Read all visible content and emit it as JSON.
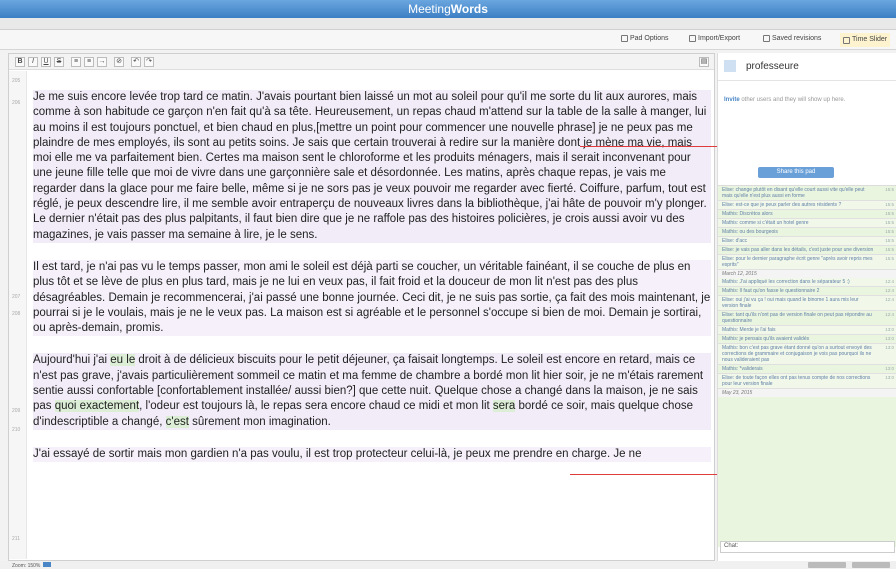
{
  "app": {
    "title_prefix": "Meeting",
    "title_bold": "Words"
  },
  "menu": {
    "pad_options": "Pad Options",
    "import_export": "Import/Export",
    "saved_revisions": "Saved revisions",
    "time_slider": "Time Slider"
  },
  "toolbar": {
    "bold": "B",
    "italic": "I",
    "underline": "U",
    "strike": "S"
  },
  "line_numbers": [
    "205",
    "206",
    "207",
    "208",
    "209",
    "210",
    "211"
  ],
  "document": {
    "p1": "Je  me suis encore levée  trop tard ce matin. J'avais pourtant bien laissé un  mot au soleil pour  qu'il me sorte du lit aux aurores, mais comme à son  habitude ce garçon  n'en fait qu'à sa tête. Heureusement, un repas chaud  m'attend sur la table de la salle à manger, lui au moins il est toujours  ponctuel, et  bien chaud en plus,[mettre un point pour commencer une nouvelle phrase] je ne peux pas me plaindre de mes  employés, ils  sont au petits soins. Je sais que certain trouverai à  redire sur la  manière dont je mène ma vie, mais moi elle me va  parfaitement bien.  Certes ma maison sent le chloroforme et les produits  ménagers, mais il  serait inconvenant pour une jeune fille telle que moi  de vivre dans une garçonnière sale et désordonnée. Les matins, après  chaque repas, je  vais me regarder dans la glace pour me faire belle,  même si je ne sors  pas je veux pouvoir me regarder avec fierté.  Coiffure, parfum, tout est  réglé, je peux descendre lire, il me semble  avoir entraperçu de  nouveaux livres dans la bibliothèque, j'ai hâte de  pouvoir m'y plonger. Le dernier n'était pas des plus palpitants, il faut  bien dire que je  ne raffole pas des histoires policières, je crois  aussi avoir vu des  magazines, je vais passer ma semaine à lire, je le  sens.",
    "p2": "Il   est tard, je n'ai pas vu le temps passer, mon ami le soleil est déjà   parti se coucher, un véritable fainéant, il se couche de plus en plus  tôt et se lève de plus en plus tard, mais je ne lui en veux pas, il  fait  froid et la douceur de mon lit n'est pas des plus désagréables.  Demain  je recommencerai, j'ai passé une bonne journée. Ceci dit, je ne  suis pas  sortie, ça fait des mois maintenant, je pourrai si je le  voulais, mais  je ne le veux pas. La maison est si agréable et le  personnel s'occupe si  bien de moi. Demain je sortirai, ou après-demain, promis.",
    "p3a": "Aujourd'hui  j'ai ",
    "p3_hl1": "eu le",
    "p3b": " droit  à de délicieux biscuits pour le petit déjeuner, ça faisait  longtemps.  Le soleil est encore en retard, mais ce n'est pas grave,  j'avais  particulièrement sommeil ce matin et ma femme de chambre a bordé  mon  lit hier soir, je ne m'étais rarement sentie aussi confortable [confortablement installée/ aussi bien?] que cette nuit. Quelque chose a changé dans la maison, je ne sais pas ",
    "p3_hl2": "quoi exactement",
    "p3c": ", l'odeur est toujours là, le repas sera encore chaud ce midi et mon lit ",
    "p3_hl3": "sera",
    "p3d": " bordé ce soir, mais quelque chose d'indescriptible a changé, ",
    "p3_hl4": "c'est",
    "p3e": " sûrement  mon imagination.",
    "p4": "J'ai   essayé de sortir mais mon gardien n'a pas voulu, il est trop protecteur  celui-là, je peux me prendre en charge. Je ne"
  },
  "sidebar": {
    "user_name": "professeure",
    "invite_link": "Invite",
    "invite_text": " other users and they will show up here.",
    "share_button": "Share this pad",
    "chat_label": "Chat:",
    "messages": [
      {
        "text": "Elise: change plutôt en disant qu'elle court aussi vite qu'elle peut mais qu'elle n'est plus aussi en forme",
        "time": "15:5"
      },
      {
        "text": "Elise: est-ce que je peux parler des autres résidents ?",
        "time": "15:5"
      },
      {
        "text": "Mathis: Discrètos alors",
        "time": "15:5"
      },
      {
        "text": "Mathis: comme si c'était un hotel genre",
        "time": "15:5"
      },
      {
        "text": "Mathis: ou des bourgeois",
        "time": "15:5"
      },
      {
        "text": "Elise: d'acc",
        "time": "15:5"
      },
      {
        "text": "Elise: je vais pas aller dans les détails, c'est juste pour une diversion",
        "time": "15:5"
      },
      {
        "text": "Elise: pour le dernier paragraphe écrit genre \"après avoir repris mes esprits\"",
        "time": "15:5"
      },
      {
        "date": "March 12, 2015"
      },
      {
        "text": "Mathis: J'ai appliqué les correction dans le séparateur 5 :)",
        "time": "12:4"
      },
      {
        "text": "Mathis: Il faut qu'on fasse le questionnaire 2",
        "time": "12:4"
      },
      {
        "text": "Elise: oui j'ai vu ça ! oui mais quand le binome 1 aura mis leur version finale",
        "time": "12:4"
      },
      {
        "text": "Elise: tant qu'ils n'ont pas de version finale on peut pas répondre au questionnaire",
        "time": "12:4"
      },
      {
        "text": "Mathis: Merde je l'ai fais",
        "time": "13:0"
      },
      {
        "text": "Mathis: je pensais qu'ils avaient validés",
        "time": "13:0"
      },
      {
        "text": "Mathis: bon c'est pas grave étant donné qu'on a surtout envoyé des corrections de grammaire et conjugaison je vois pas pourquoi ils ne nous valideraient pas",
        "time": "13:0"
      },
      {
        "text": "Mathis: *validerais",
        "time": "13:0"
      },
      {
        "text": "Elise: de toute façon elles ont pas tenus compte de nos corrections pour leur version finale",
        "time": "13:0"
      },
      {
        "date": "May 23, 2015"
      }
    ]
  },
  "status": {
    "zoom_label": "Zoom:",
    "zoom_value": "150%"
  }
}
